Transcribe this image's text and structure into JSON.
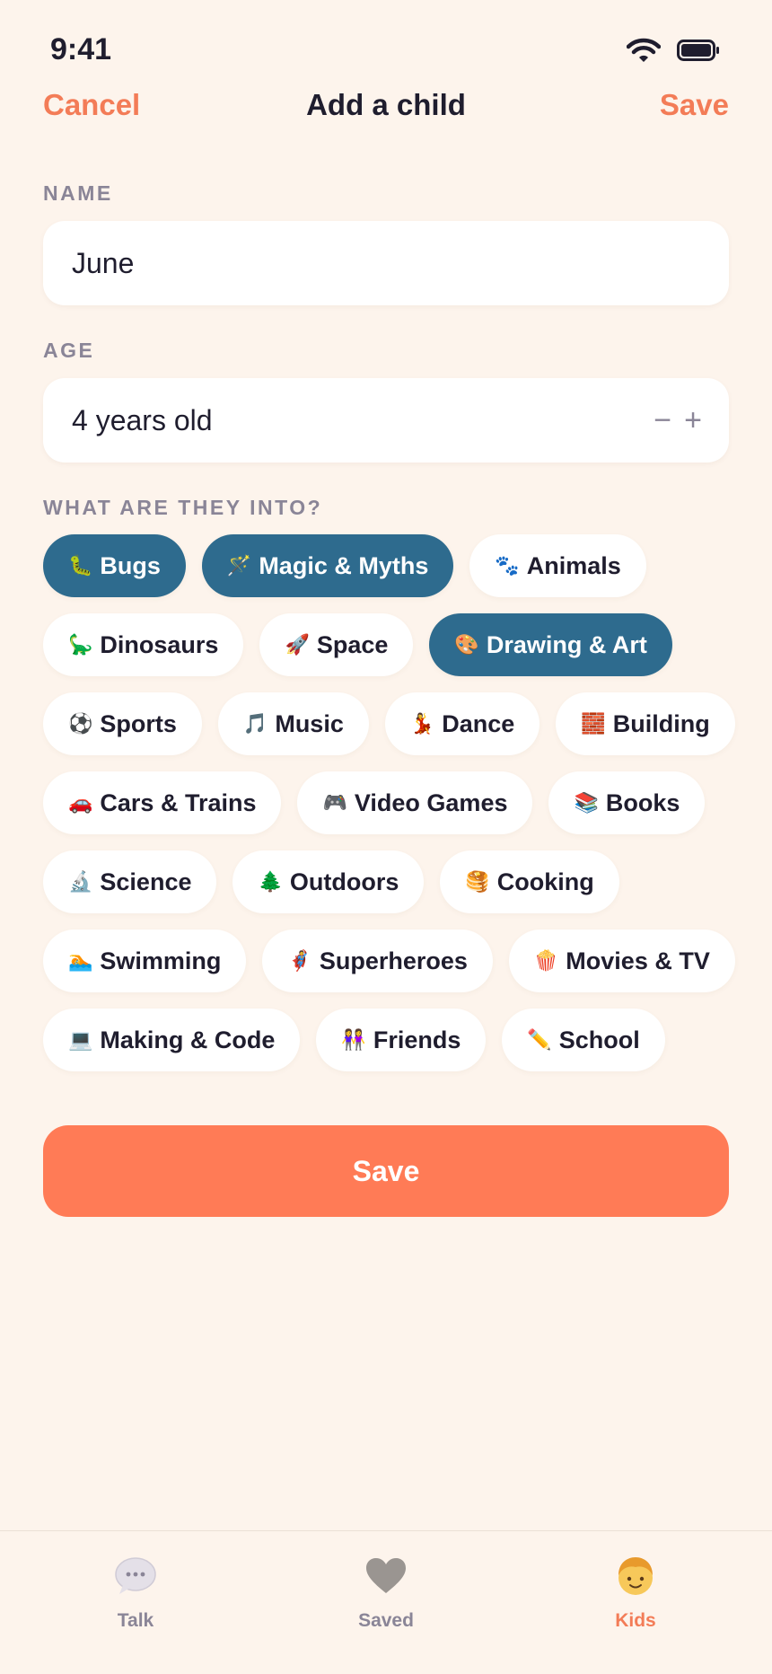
{
  "status": {
    "time": "9:41"
  },
  "nav": {
    "cancel": "Cancel",
    "title": "Add a child",
    "save": "Save"
  },
  "name": {
    "label": "NAME",
    "value": "June"
  },
  "age": {
    "label": "AGE",
    "value": "4 years old",
    "minus": "−",
    "plus": "+"
  },
  "interests": {
    "label": "WHAT ARE THEY INTO?",
    "chips": [
      {
        "emoji": "🐛",
        "label": "Bugs",
        "selected": true
      },
      {
        "emoji": "🪄",
        "label": "Magic & Myths",
        "selected": true
      },
      {
        "emoji": "🐾",
        "label": "Animals",
        "selected": false
      },
      {
        "emoji": "🦕",
        "label": "Dinosaurs",
        "selected": false
      },
      {
        "emoji": "🚀",
        "label": "Space",
        "selected": false
      },
      {
        "emoji": "🎨",
        "label": "Drawing & Art",
        "selected": true
      },
      {
        "emoji": "⚽",
        "label": "Sports",
        "selected": false
      },
      {
        "emoji": "🎵",
        "label": "Music",
        "selected": false
      },
      {
        "emoji": "💃",
        "label": "Dance",
        "selected": false
      },
      {
        "emoji": "🧱",
        "label": "Building",
        "selected": false
      },
      {
        "emoji": "🚗",
        "label": "Cars & Trains",
        "selected": false
      },
      {
        "emoji": "🎮",
        "label": "Video Games",
        "selected": false
      },
      {
        "emoji": "📚",
        "label": "Books",
        "selected": false
      },
      {
        "emoji": "🔬",
        "label": "Science",
        "selected": false
      },
      {
        "emoji": "🌲",
        "label": "Outdoors",
        "selected": false
      },
      {
        "emoji": "🥞",
        "label": "Cooking",
        "selected": false
      },
      {
        "emoji": "🏊",
        "label": "Swimming",
        "selected": false
      },
      {
        "emoji": "🦸",
        "label": "Superheroes",
        "selected": false
      },
      {
        "emoji": "🍿",
        "label": "Movies & TV",
        "selected": false
      },
      {
        "emoji": "💻",
        "label": "Making & Code",
        "selected": false
      },
      {
        "emoji": "👭",
        "label": "Friends",
        "selected": false
      },
      {
        "emoji": "✏️",
        "label": "School",
        "selected": false
      }
    ]
  },
  "save_button": "Save",
  "tabs": [
    {
      "label": "Talk",
      "icon": "speech-bubble-icon",
      "active": false
    },
    {
      "label": "Saved",
      "icon": "heart-icon",
      "active": false
    },
    {
      "label": "Kids",
      "icon": "child-face-icon",
      "active": true
    }
  ],
  "colors": {
    "background": "#fdf4ec",
    "accent": "#f37c57",
    "save_button": "#ff7b56",
    "chip_selected": "#2e6b8e",
    "text": "#1f1d2e",
    "muted": "#8a8597"
  }
}
